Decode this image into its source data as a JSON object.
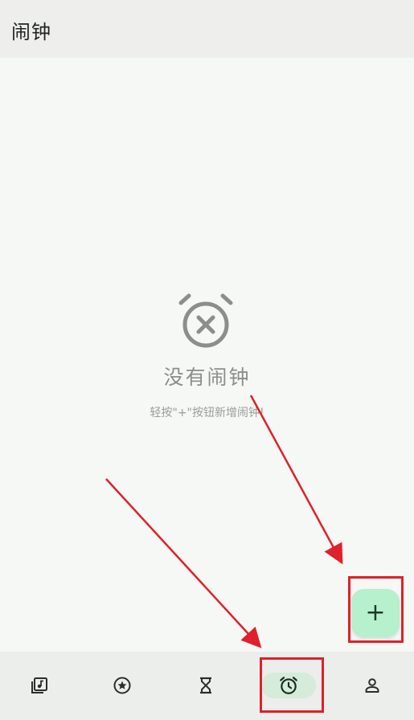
{
  "app_bar": {
    "title": "闹钟"
  },
  "empty_state": {
    "icon": "alarm-off-icon",
    "title": "没有闹钟",
    "hint": "轻按\"+\"按钮新增闹钟!"
  },
  "fab": {
    "label": "+",
    "icon": "plus-icon"
  },
  "bottom_nav": {
    "items": [
      {
        "name": "music-library",
        "icon": "music-library-icon",
        "active": false
      },
      {
        "name": "favorites",
        "icon": "star-circle-icon",
        "active": false
      },
      {
        "name": "timer",
        "icon": "hourglass-icon",
        "active": false
      },
      {
        "name": "alarm",
        "icon": "alarm-clock-icon",
        "active": true
      },
      {
        "name": "profile",
        "icon": "person-icon",
        "active": false
      }
    ]
  },
  "colors": {
    "background": "#f6f8f5",
    "accent": "#b6f0cc",
    "active_pill": "#d4ecd9",
    "annotation_red": "#e0202a"
  }
}
